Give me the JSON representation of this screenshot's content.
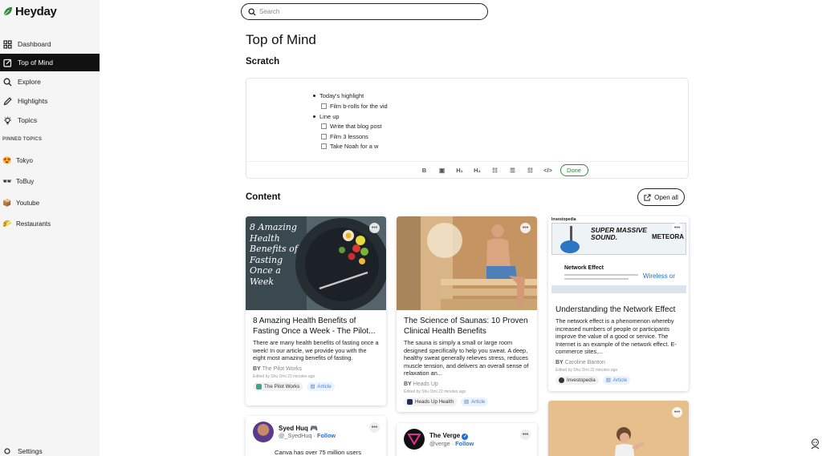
{
  "app": {
    "name": "Heyday",
    "accent": "#2e8b3d"
  },
  "sidebar": {
    "nav": [
      {
        "label": "Dashboard",
        "icon": "grid-icon"
      },
      {
        "label": "Top of Mind",
        "icon": "edit-note-icon",
        "active": true
      },
      {
        "label": "Explore",
        "icon": "search-icon"
      },
      {
        "label": "Highlights",
        "icon": "pen-icon"
      },
      {
        "label": "Topics",
        "icon": "bulb-icon"
      }
    ],
    "pinned_heading": "PINNED TOPICS",
    "pinned": [
      {
        "label": "Tokyo",
        "icon": "😍"
      },
      {
        "label": "ToBuy",
        "icon": "🕶"
      },
      {
        "label": "Youtube",
        "icon": "📦"
      },
      {
        "label": "Restaurants",
        "icon": "🌮"
      }
    ],
    "settings": "Settings"
  },
  "search": {
    "placeholder": "Search"
  },
  "page_title": "Top of Mind",
  "scratch": {
    "title": "Scratch",
    "bullets": [
      {
        "text": "Today's highlight",
        "todos": [
          "Film b-rolls for the vid"
        ]
      },
      {
        "text": "Line up",
        "todos": [
          "Write that blog post",
          "Film 3 lessons",
          "Take Noah for a w"
        ]
      }
    ],
    "toolbar": {
      "bold": "B",
      "code_block": "▣",
      "h1": "H₁",
      "h2": "H₂",
      "checklist": "☷",
      "bullets": "☰",
      "numbered": "☷",
      "code": "</>",
      "done": "Done"
    }
  },
  "content": {
    "title": "Content",
    "open_all": "Open all",
    "cards": [
      {
        "thumb_text": "8 Amazing Health Benefits of Fasting Once a Week",
        "title": "8 Amazing Health Benefits of Fasting Once a Week - The Pilot...",
        "desc": "There are many health benefits of fasting once a week! In our article, we provide you with the eight most amazing benefits of fasting.",
        "by_prefix": "BY",
        "by": "The Pilot Works",
        "edited": "Edited by Shu Omi 23 minutes ago",
        "source": "The Pilot Works",
        "type": "Article"
      },
      {
        "title": "The Science of Saunas: 10 Proven Clinical Health Benefits",
        "desc": "The sauna is simply a small or large room designed specifically to help you sweat. A deep, healthy sweat generally relieves stress, reduces muscle tension, and delivers an overall sense of relaxation an...",
        "by_prefix": "BY",
        "by": "Heads Up",
        "edited": "Edited by Shu Omi 22 minutes ago",
        "source": "Heads Up Health",
        "type": "Article"
      },
      {
        "thumb_brand": "Investopedia",
        "thumb_article": "Network Effect",
        "thumb_ad": "Wireless or",
        "thumb_banner": "SUPER MASSIVE SOUND.",
        "thumb_banner_brand": "METEORA",
        "title": "Understanding the Network Effect",
        "desc": "The network effect is a phenomenon whereby increased numbers of people or participants improve the value of a good or service. The Internet is an example of the network effect. E-commerce sites,...",
        "by_prefix": "BY",
        "by": "Caroline Banton",
        "edited": "Edited by Shu Omi 22 minutes ago",
        "source": "Investopedia",
        "type": "Article"
      }
    ],
    "tweets": [
      {
        "name": "Syed Huq 🎮",
        "handle": "@_SyedHuq",
        "follow": "Follow",
        "text": "Canva has over 75 million users"
      },
      {
        "name": "The Verge",
        "handle": "@verge",
        "follow": "Follow"
      }
    ]
  }
}
